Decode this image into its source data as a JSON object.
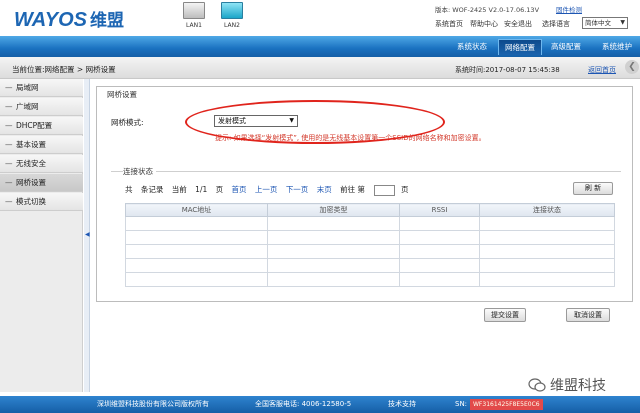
{
  "header": {
    "logo": "WAYOS",
    "logo_cn": "维盟",
    "lan1_label": "LAN1",
    "lan2_label": "LAN2",
    "version": "版本: WOF-2425 V2.0-17.06.13V",
    "upgrade": "固件检测",
    "links": {
      "home": "系统首页",
      "help": "帮助中心",
      "logout": "安全退出",
      "lang": "选择语言"
    },
    "lang_value": "简体中文"
  },
  "nav": {
    "tabs": [
      "系统状态",
      "网络配置",
      "高级配置",
      "系统维护"
    ],
    "active_tab": "网络配置"
  },
  "statusbar": {
    "breadcrumb": "当前位置:网络配置  >  网桥设置",
    "systime": "系统时间:2017-08-07 15:45:38",
    "back": "返回首页"
  },
  "sidebar": {
    "items": [
      "局域网",
      "广域网",
      "DHCP配置",
      "基本设置",
      "无线安全",
      "网桥设置",
      "模式切换"
    ],
    "active": "网桥设置"
  },
  "bridge": {
    "section_title": "网桥设置",
    "mode_label": "网桥模式:",
    "mode_value": "发射模式",
    "hint": "提示: 如果选择“发射模式”, 使用的是无线基本设置第一个SSID的网络名称和加密设置。"
  },
  "connection": {
    "title": "连接状态",
    "pager": {
      "total": "共",
      "records": "条记录",
      "current": "当前",
      "page_info": "1/1",
      "page": "页",
      "first": "首页",
      "prev": "上一页",
      "next": "下一页",
      "last": "末页",
      "goto": "前往 第",
      "page_suffix": "页"
    },
    "refresh": "刷 新",
    "columns": [
      "MAC地址",
      "加密类型",
      "RSSI",
      "连接状态"
    ],
    "rows": [
      [
        "",
        "",
        "",
        ""
      ],
      [
        "",
        "",
        "",
        ""
      ],
      [
        "",
        "",
        "",
        ""
      ],
      [
        "",
        "",
        "",
        ""
      ],
      [
        "",
        "",
        "",
        ""
      ]
    ]
  },
  "actions": {
    "submit": "提交设置",
    "cancel": "取消设置"
  },
  "watermark": "维盟科技",
  "footer": {
    "copyright": "深圳维盟科技股份有限公司版权所有",
    "phone": "全国客服电话: 4006-12580-5",
    "support": "技术支持",
    "sn_label": "SN:",
    "sn": "WF3161425F8E5E0C6"
  },
  "colors": {
    "brand_blue": "#1d66b3",
    "hint_red": "#d33a2c",
    "annotation_red": "#e0241c"
  }
}
